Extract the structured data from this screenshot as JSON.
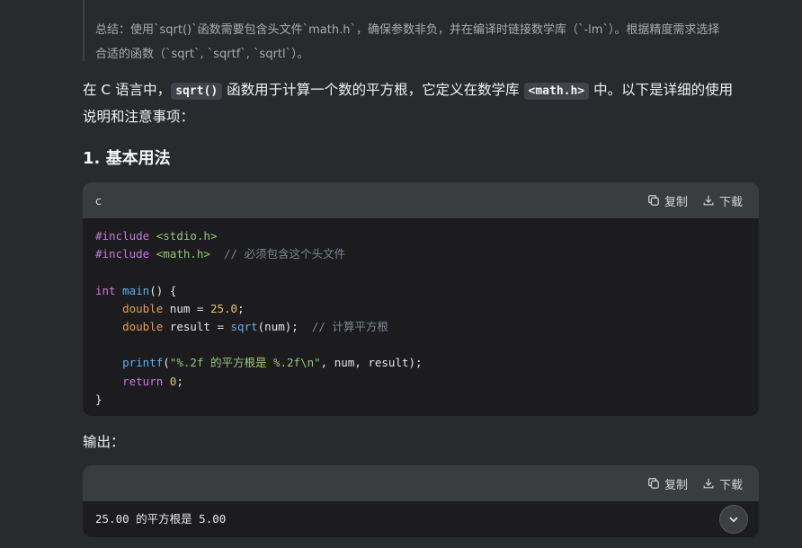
{
  "summary": {
    "line1": "总结：使用`sqrt()`函数需要包含头文件`math.h`，确保参数非负，并在编译时链接数学库（`-lm`）。根据精度需求选择",
    "line2": "合适的函数（`sqrt`, `sqrtf`, `sqrtl`）。"
  },
  "intro": {
    "t1": "在 C 语言中，",
    "c1": "sqrt()",
    "t2": " 函数用于计算一个数的平方根，它定义在数学库 ",
    "c2": "<math.h>",
    "t3": " 中。以下是详细的使用",
    "line2": "说明和注意事项："
  },
  "section_title": "1. 基本用法",
  "code_block_1": {
    "language": "c",
    "copy_label": "复制",
    "download_label": "下载",
    "inc1_kw": "#include",
    "inc1_hdr": "<stdio.h>",
    "inc2_kw": "#include",
    "inc2_hdr": "<math.h>",
    "inc2_cm": "// 必须包含这个头文件",
    "main_type": "int",
    "main_fn": "main",
    "main_rest": "() {",
    "l1_type": "double",
    "l1_mid": " num = ",
    "l1_num": "25.0",
    "l1_end": ";",
    "l2_type": "double",
    "l2_mid": " result = ",
    "l2_fn": "sqrt",
    "l2_end": "(num);",
    "l2_cm": "// 计算平方根",
    "l3_fn": "printf",
    "l3_open": "(",
    "l3_str": "\"%.2f 的平方根是 %.2f\\n\"",
    "l3_end": ", num, result);",
    "l4_kw": "return",
    "l4_num": "0",
    "l4_end": ";",
    "close": "}"
  },
  "output_label": "输出：",
  "code_block_2": {
    "copy_label": "复制",
    "download_label": "下载",
    "output": "25.00 的平方根是 5.00"
  },
  "icons": {
    "copy": "copy-icon",
    "download": "download-icon",
    "scroll": "chevron-down-icon"
  }
}
